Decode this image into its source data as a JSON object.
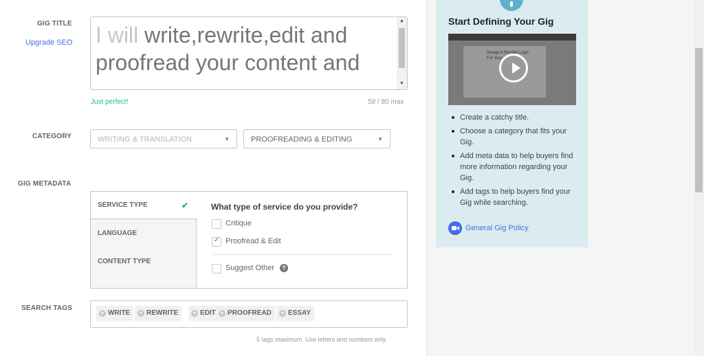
{
  "gig_title": {
    "label": "GIG TITLE",
    "upgrade_link": "Upgrade SEO",
    "prefix": "I will ",
    "text": "write,rewrite,edit and proofread your content and",
    "status": "Just perfect!",
    "count": "58",
    "max": " / 80 max"
  },
  "category": {
    "label": "CATEGORY",
    "primary": "WRITING & TRANSLATION",
    "secondary": "PROOFREADING & EDITING"
  },
  "metadata": {
    "label": "GIG METADATA",
    "nav": [
      "SERVICE TYPE",
      "LANGUAGE",
      "CONTENT TYPE"
    ],
    "question": "What type of service do you provide?",
    "options": [
      {
        "label": "Critique",
        "checked": false
      },
      {
        "label": "Proofread & Edit",
        "checked": true
      }
    ],
    "suggest_other": "Suggest Other"
  },
  "search_tags": {
    "label": "SEARCH TAGS",
    "tags": [
      "WRITE",
      "REWRITE",
      "EDIT",
      "PROOFREAD",
      "ESSAY"
    ],
    "hint": "5 tags maximum. Use letters and numbers only."
  },
  "sidebar": {
    "title": "Start Defining Your Gig",
    "bullets": [
      "Create a catchy title.",
      "Choose a category that fits your Gig.",
      "Add meta data to help buyers find more information regarding your Gig.",
      "Add tags to help buyers find your Gig while searching."
    ],
    "policy_link": "General Gig Policy",
    "video_thumb_text": "Design A Bot My! Logo For Your"
  },
  "colors": {
    "accent": "#1dbf73",
    "link": "#446ee7",
    "sidebar_bg": "#dbecf0"
  }
}
